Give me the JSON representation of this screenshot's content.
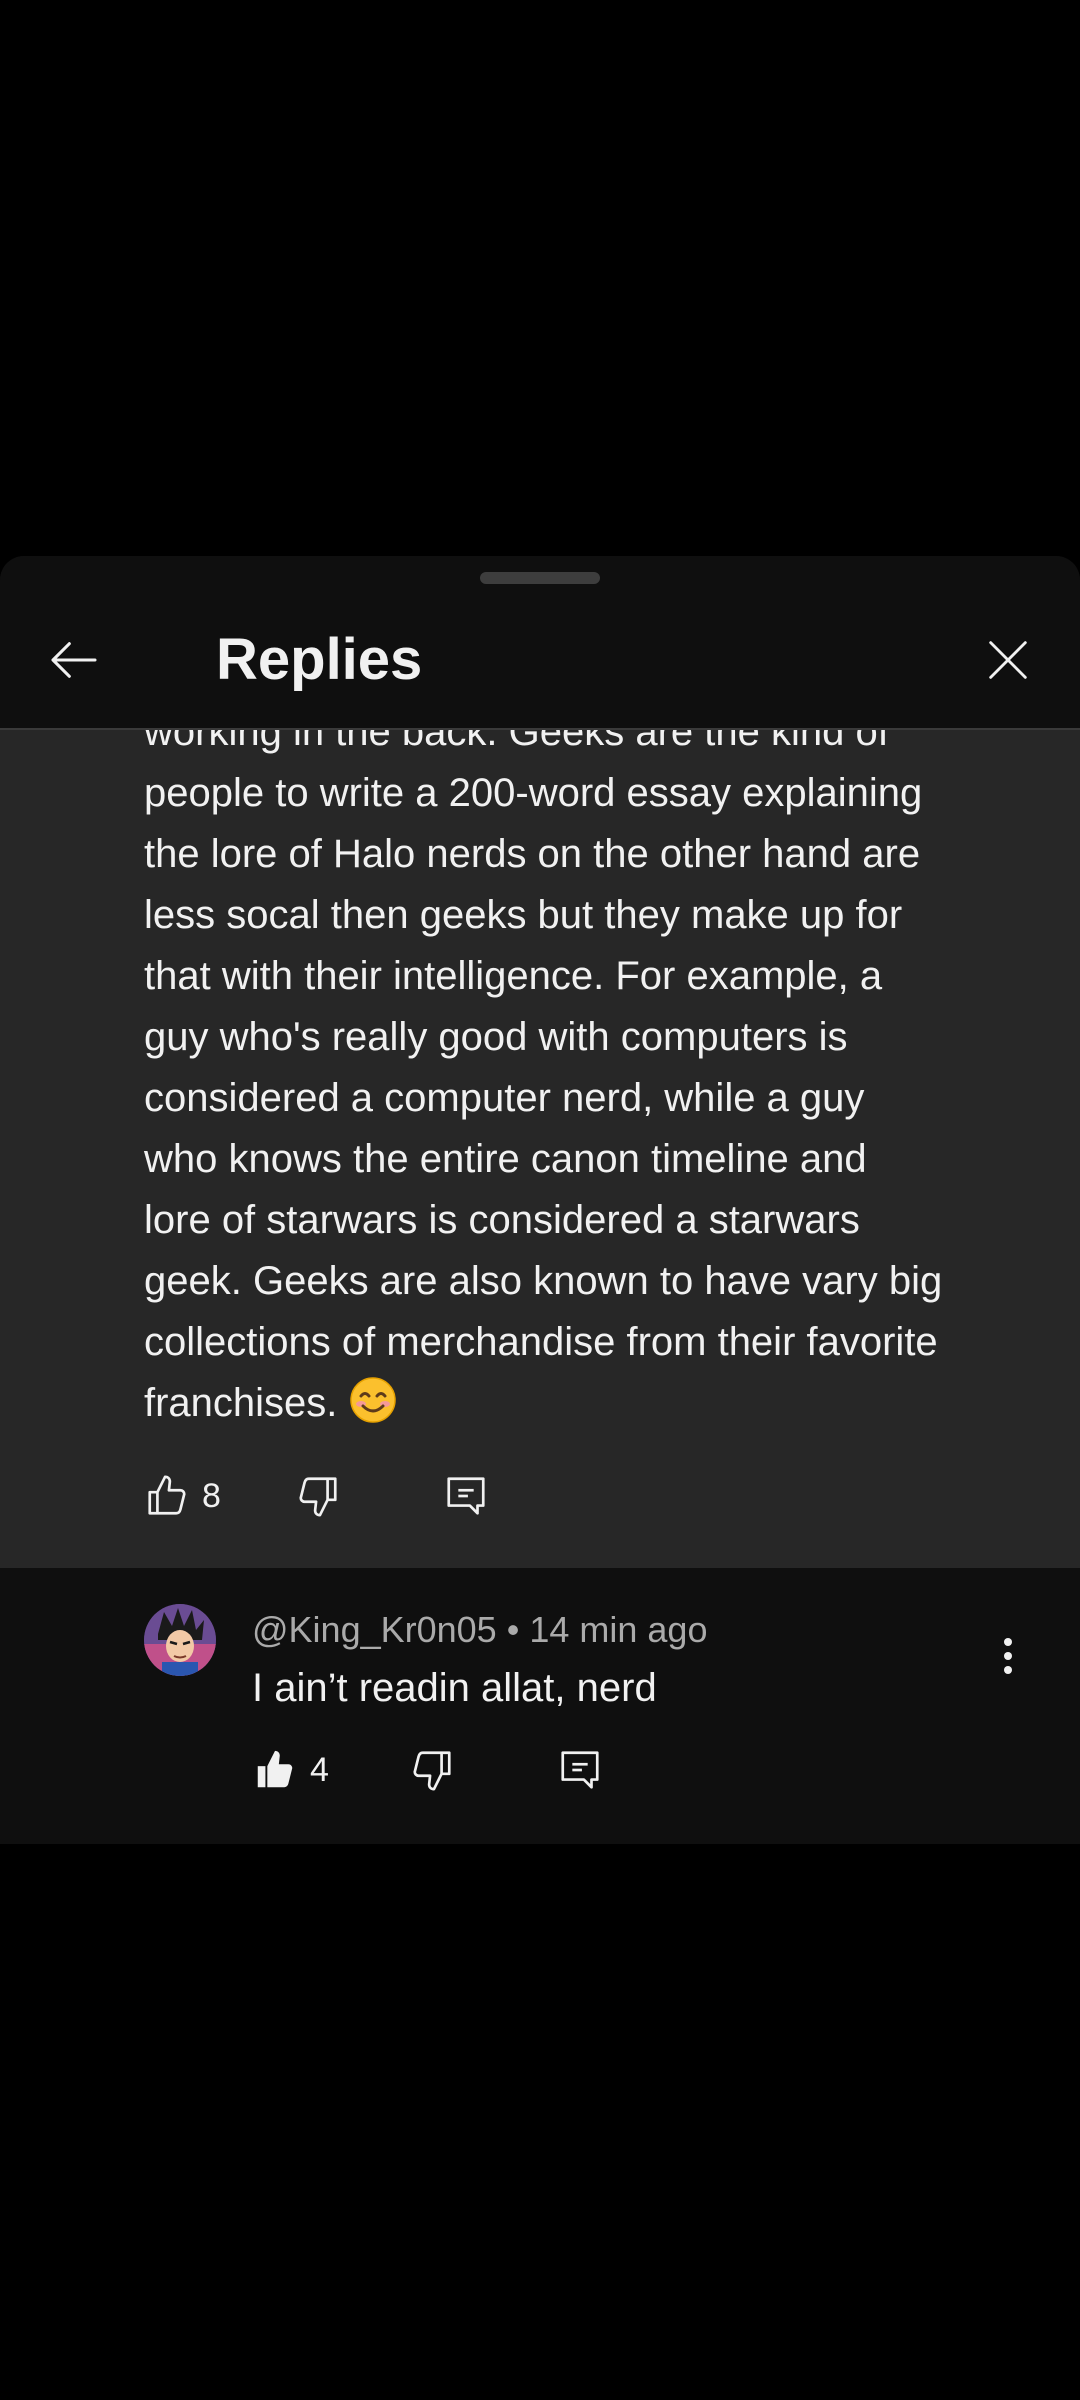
{
  "header": {
    "title": "Replies"
  },
  "highlighted_comment": {
    "cut_off_line": "working in the back. Geeks are the kind of",
    "lines": [
      "people to write a 200-word essay explaining",
      "the lore of Halo nerds on the other hand are",
      "less socal then geeks but they make up for",
      "that with their intelligence. For example, a",
      "guy who's really good with computers is",
      "considered a computer nerd, while a guy",
      "who knows the entire canon timeline and",
      "lore of starwars is considered a starwars",
      "geek. Geeks are also known to have vary big",
      "collections of merchandise from their favorite",
      "franchises."
    ],
    "emoji": "smiling-face-emoji",
    "like_count": "8"
  },
  "reply": {
    "author": "@King_Kr0n05",
    "separator": "•",
    "time": "14 min ago",
    "text": "I ain’t readin allat, nerd",
    "like_count": "4",
    "liked": true
  },
  "colors": {
    "background": "#000000",
    "sheet": "#0f0f0f",
    "highlight": "#272727",
    "text": "#f1f1f1",
    "secondary_text": "#aaaaaa"
  }
}
